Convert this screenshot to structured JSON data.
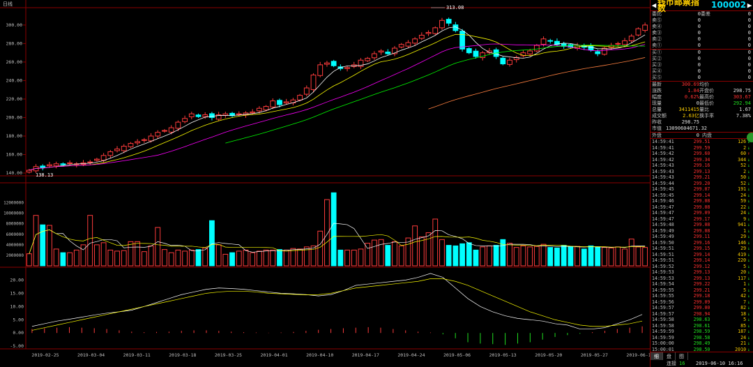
{
  "chart_title": "日线",
  "colors": {
    "up": "#ff3c3c",
    "down": "#00ffff",
    "ma5": "#ffffff",
    "ma10": "#ffff00",
    "ma20": "#ff00ff",
    "ma30": "#00ff00",
    "ma60": "#ff8040"
  },
  "chart_data": [
    {
      "type": "candlestick",
      "title": "日线",
      "x_labels": [
        "2019-02-25",
        "2019-03-04",
        "2019-03-11",
        "2019-03-18",
        "2019-03-25",
        "2019-04-01",
        "2019-04-10",
        "2019-04-17",
        "2019-04-24",
        "2019-05-06",
        "2019-05-13",
        "2019-05-20",
        "2019-05-27",
        "2019-06-10"
      ],
      "ylim": [
        137,
        318
      ],
      "yticks": [
        "300.00",
        "280.00",
        "260.00",
        "240.00",
        "220.00",
        "200.00",
        "180.00",
        "160.00",
        "140.00"
      ],
      "annotations": [
        {
          "text": "313.08"
        },
        {
          "text": "138.13"
        }
      ],
      "closes": [
        143,
        147,
        146,
        149,
        150,
        149,
        151,
        150,
        151,
        152,
        155,
        159,
        163,
        166,
        169,
        172,
        174,
        176,
        180,
        184,
        186,
        189,
        195,
        199,
        204,
        201,
        203,
        200,
        203,
        204,
        202,
        204,
        205,
        206,
        210,
        212,
        218,
        214,
        217,
        219,
        224,
        232,
        246,
        257,
        259,
        256,
        253,
        254,
        257,
        262,
        264,
        269,
        272,
        269,
        275,
        279,
        281,
        285,
        289,
        292,
        297,
        305,
        302,
        294,
        274,
        270,
        266,
        270,
        272,
        266,
        258,
        262,
        265,
        270,
        272,
        278,
        285,
        283,
        279,
        277,
        276,
        278,
        276,
        273,
        269,
        275,
        278,
        280,
        283,
        288,
        296,
        300
      ]
    },
    {
      "type": "bar",
      "title": "volume",
      "ylim": [
        0,
        15000000
      ],
      "yticks": [
        "12000000",
        "10000000",
        "8000000",
        "6000000",
        "4000000",
        "2000000"
      ],
      "values": [
        2.3,
        9.6,
        7.8,
        7.7,
        3.2,
        2.5,
        2.5,
        3.0,
        4.0,
        9.6,
        4.0,
        4.4,
        3.0,
        2.8,
        2.9,
        4.6,
        4.6,
        2.7,
        3.8,
        7.3,
        3.1,
        2.5,
        3.0,
        2.8,
        3.0,
        3.1,
        3.4,
        8.6,
        4.0,
        2.2,
        2.5,
        2.8,
        3.0,
        2.5,
        2.8,
        3.0,
        3.0,
        3.1,
        3.0,
        3.3,
        3.2,
        3.6,
        3.8,
        6.6,
        12.6,
        13.9,
        3.0,
        3.0,
        3.0,
        3.2,
        4.3,
        4.9,
        5.0,
        3.9,
        4.6,
        3.8,
        5.3,
        7.6,
        5.5,
        6.3,
        8.9,
        5.0,
        3.9,
        3.8,
        4.2,
        4.4,
        3.0,
        3.6,
        3.8,
        3.9,
        5.0,
        4.3,
        3.5,
        3.8,
        3.6,
        3.7,
        4.1,
        3.5,
        3.4,
        3.9,
        3.6,
        3.7,
        3.2,
        3.8,
        3.6,
        3.5,
        3.4,
        3.6,
        3.2,
        5.1,
        3.6,
        3.5
      ]
    },
    {
      "type": "line",
      "title": "macd",
      "ylim": [
        -6,
        23
      ],
      "yticks": [
        "20.00",
        "15.00",
        "10.00",
        "5.00",
        "0.00",
        "-5.00"
      ],
      "series": [
        {
          "values": [
            2.5,
            3.5,
            4.5,
            5.2,
            6.0,
            6.8,
            7.5,
            8.0,
            8.6,
            10.0,
            11.5,
            13.0,
            14.5,
            15.5,
            16.5,
            17.0,
            16.8,
            16.5,
            16.0,
            15.5,
            15.0,
            14.8,
            14.5,
            14.0,
            14.5,
            16.0,
            18.0,
            18.5,
            19.0,
            19.5,
            20.0,
            21.0,
            22.5,
            21.0,
            17.0,
            13.0,
            10.0,
            8.0,
            6.5,
            5.5,
            5.0,
            4.5,
            3.5,
            3.0,
            1.5,
            1.5,
            2.0,
            3.5,
            5.0,
            7.0
          ]
        },
        {
          "values": [
            1.0,
            2.0,
            3.0,
            4.0,
            5.0,
            6.0,
            7.0,
            8.0,
            9.0,
            10.0,
            11.0,
            12.0,
            13.0,
            14.0,
            15.0,
            15.5,
            15.8,
            15.8,
            15.5,
            15.0,
            14.8,
            14.6,
            14.4,
            14.5,
            15.0,
            16.0,
            17.0,
            17.5,
            18.0,
            18.5,
            19.0,
            19.5,
            20.5,
            20.5,
            19.5,
            18.0,
            16.0,
            14.0,
            12.0,
            10.0,
            8.0,
            6.5,
            5.0,
            4.0,
            3.0,
            2.5,
            2.5,
            3.0,
            3.5,
            4.5
          ]
        }
      ],
      "histogram": [
        1.5,
        1.8,
        2.0,
        2.2,
        2.0,
        1.8,
        1.5,
        1.0,
        0.5,
        0.3,
        0.4,
        0.5,
        0.8,
        1.0,
        1.0,
        0.8,
        0.5,
        0.3,
        0.2,
        0.1,
        0.2,
        0.4,
        0.8,
        1.2,
        1.5,
        1.8,
        2.0,
        2.2,
        2.0,
        1.5,
        1.0,
        0.5,
        0.2,
        -0.5,
        -2.0,
        -3.5,
        -4.0,
        -4.2,
        -4.5,
        -4.0,
        -3.5,
        -2.5,
        -1.5,
        -0.8,
        -0.3,
        0.3,
        0.8,
        1.5,
        2.0,
        2.5
      ]
    }
  ],
  "panel": {
    "title": "钱币邮票指数",
    "code": "100002",
    "order_rows": [
      {
        "label": "委比",
        "v1": "0",
        "label2": "委差",
        "v2": "0"
      },
      {
        "label": "卖⑤",
        "v1": "0",
        "v2": "0"
      },
      {
        "label": "卖④",
        "v1": "0",
        "v2": "0"
      },
      {
        "label": "卖③",
        "v1": "0",
        "v2": "0"
      },
      {
        "label": "卖②",
        "v1": "0",
        "v2": "0"
      },
      {
        "label": "卖①",
        "v1": "0",
        "v2": "0"
      }
    ],
    "buy_rows": [
      {
        "label": "买①",
        "v1": "0",
        "v2": "0"
      },
      {
        "label": "买②",
        "v1": "0",
        "v2": "0"
      },
      {
        "label": "买③",
        "v1": "0",
        "v2": "0"
      },
      {
        "label": "买④",
        "v1": "0",
        "v2": "0"
      },
      {
        "label": "买⑤",
        "v1": "0",
        "v2": "0"
      }
    ],
    "stats": [
      {
        "l1": "最新",
        "v1": "300.69",
        "c1": "red",
        "l2": "均价",
        "v2": "",
        "c2": "wht"
      },
      {
        "l1": "涨跌",
        "v1": "1.84",
        "c1": "red",
        "l2": "开盘价",
        "v2": "298.75",
        "c2": "wht"
      },
      {
        "l1": "幅度",
        "v1": "0.62%",
        "c1": "red",
        "l2": "最高价",
        "v2": "303.67",
        "c2": "red"
      },
      {
        "l1": "现量",
        "v1": "0",
        "c1": "wht",
        "l2": "最低价",
        "v2": "292.94",
        "c2": "grn"
      },
      {
        "l1": "总量",
        "v1": "3411415",
        "c1": "yel",
        "l2": "量比",
        "v2": "1.67",
        "c2": "wht"
      },
      {
        "l1": "成交额",
        "v1": "2.63亿",
        "c1": "yel",
        "l2": "换手率",
        "v2": "7.38%",
        "c2": "wht"
      },
      {
        "l1": "昨收",
        "v1": "298.75",
        "c1": "wht",
        "l2": "",
        "v2": "",
        "c2": "wht"
      },
      {
        "l1": "市值",
        "v1": "13090604671.32",
        "c1": "wht",
        "l2": "",
        "v2": "",
        "c2": "wht"
      }
    ],
    "outer_label": "外盘",
    "outer_val": "0",
    "inner_label": "内盘",
    "inner_val": "0",
    "ticks": [
      {
        "t": "14:59:41",
        "p": "299.51",
        "v": "126",
        "d": "↓"
      },
      {
        "t": "14:59:41",
        "p": "299.59",
        "v": "2",
        "d": "↓"
      },
      {
        "t": "14:59:42",
        "p": "299.60",
        "v": "60",
        "d": "↑"
      },
      {
        "t": "14:59:42",
        "p": "299.34",
        "v": "344",
        "d": "↓"
      },
      {
        "t": "14:59:43",
        "p": "299.16",
        "v": "52",
        "d": "↓"
      },
      {
        "t": "14:59:43",
        "p": "299.13",
        "v": "2",
        "d": "↓"
      },
      {
        "t": "14:59:43",
        "p": "299.21",
        "v": "50",
        "d": "↓"
      },
      {
        "t": "14:59:44",
        "p": "299.20",
        "v": "52",
        "d": "↓"
      },
      {
        "t": "14:59:45",
        "p": "299.07",
        "v": "191",
        "d": "↓"
      },
      {
        "t": "14:59:45",
        "p": "299.14",
        "v": "24",
        "d": "↓"
      },
      {
        "t": "14:59:46",
        "p": "299.08",
        "v": "59",
        "d": "↓"
      },
      {
        "t": "14:59:47",
        "p": "299.08",
        "v": "22",
        "d": "↓"
      },
      {
        "t": "14:59:47",
        "p": "299.09",
        "v": "24",
        "d": "↓"
      },
      {
        "t": "14:59:47",
        "p": "299.17",
        "v": "9",
        "d": "↓"
      },
      {
        "t": "14:59:48",
        "p": "299.08",
        "v": "941",
        "d": "↓"
      },
      {
        "t": "14:59:49",
        "p": "299.08",
        "v": "1",
        "d": "↓"
      },
      {
        "t": "14:59:49",
        "p": "299.11",
        "v": "29",
        "d": "↓"
      },
      {
        "t": "14:59:50",
        "p": "299.16",
        "v": "146",
        "d": "↓"
      },
      {
        "t": "14:59:51",
        "p": "299.15",
        "v": "29",
        "d": "↓"
      },
      {
        "t": "14:59:51",
        "p": "299.14",
        "v": "419",
        "d": "↓"
      },
      {
        "t": "14:59:51",
        "p": "299.14",
        "v": "220",
        "d": "↓"
      },
      {
        "t": "14:59:52",
        "p": "299.12",
        "v": "5",
        "d": "↓"
      },
      {
        "t": "14:59:53",
        "p": "299.13",
        "v": "20",
        "d": "↓"
      },
      {
        "t": "14:59:53",
        "p": "299.13",
        "v": "117",
        "d": "↓"
      },
      {
        "t": "14:59:54",
        "p": "299.22",
        "v": "1",
        "d": "↓"
      },
      {
        "t": "14:59:55",
        "p": "299.21",
        "v": "5",
        "d": "↓"
      },
      {
        "t": "14:59:55",
        "p": "299.18",
        "v": "42",
        "d": "↓"
      },
      {
        "t": "14:59:56",
        "p": "299.09",
        "v": "7",
        "d": "↓"
      },
      {
        "t": "14:59:57",
        "p": "299.00",
        "v": "82",
        "d": "↓"
      },
      {
        "t": "14:59:57",
        "p": "298.94",
        "v": "18",
        "d": "↓"
      },
      {
        "t": "14:59:58",
        "p": "298.63",
        "v": "5",
        "d": "↓"
      },
      {
        "t": "14:59:58",
        "p": "298.61",
        "v": "85",
        "d": "↓"
      },
      {
        "t": "14:59:59",
        "p": "298.59",
        "v": "187",
        "d": "↓"
      },
      {
        "t": "14:59:59",
        "p": "298.58",
        "v": "24",
        "d": "↓"
      },
      {
        "t": "15:00:00",
        "p": "298.49",
        "v": "21",
        "d": "↓"
      },
      {
        "t": "15:00:01",
        "p": "298.50",
        "v": "2010",
        "d": "↓"
      }
    ],
    "tabs": [
      "细",
      "盘",
      "图"
    ],
    "status_label": "连接",
    "status_count": "16",
    "status_time": "2019-06-10 16:16"
  }
}
